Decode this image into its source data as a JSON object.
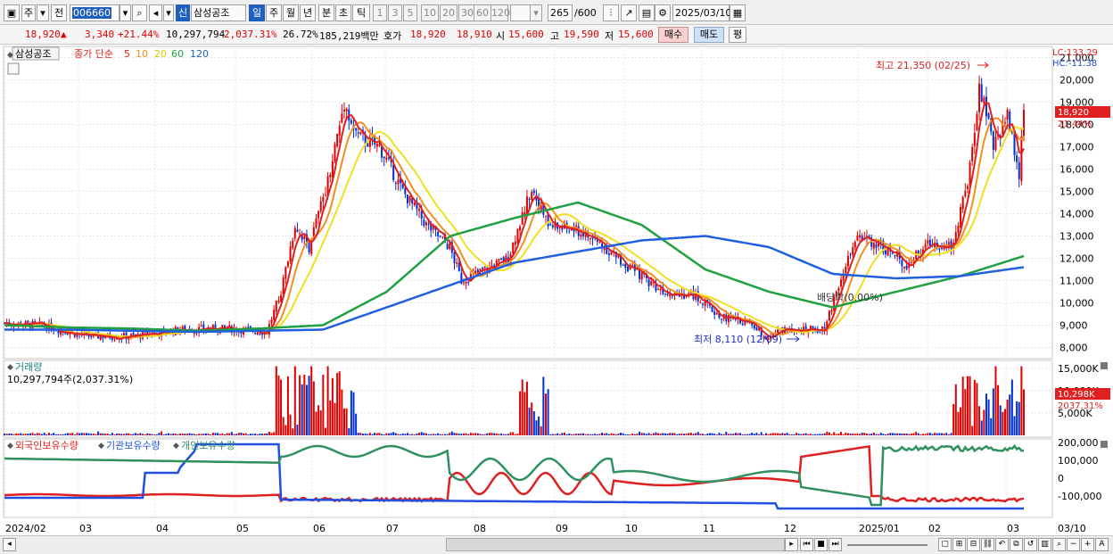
{
  "toolbar": {
    "period_tabs": [
      "주",
      "전"
    ],
    "stock_code": "006660",
    "new_badge": "신",
    "stock_name": "삼성공조",
    "timeframes": [
      "일",
      "주",
      "월",
      "년",
      "분",
      "초",
      "틱"
    ],
    "tick_counts": [
      "1",
      "3",
      "5",
      "10",
      "20",
      "30",
      "60",
      "120"
    ],
    "view_count": "265",
    "view_total": "/600",
    "date": "2025/03/10"
  },
  "info": {
    "price": "18,920",
    "change": "3,340",
    "change_pct": "+21.44%",
    "volume": "10,297,794",
    "volume_pct": "2,037.31%",
    "turnover": "26.72%",
    "amount": "185,219백만",
    "quote_label": "호가",
    "ask": "18,920",
    "bid": "18,910",
    "open_label": "시",
    "open": "15,600",
    "high_label": "고",
    "high": "19,590",
    "low_label": "저",
    "low": "15,600",
    "buy_label": "매수",
    "sell_label": "매도",
    "avg_label": "평"
  },
  "colors": {
    "up": "#e00000",
    "down": "#0030d0",
    "ma5": "#e02020",
    "ma10": "#f09020",
    "ma20": "#f0e020",
    "ma60": "#20a040",
    "ma120": "#2060e0",
    "foreign": "#e02020",
    "institution": "#2050e0",
    "individual": "#309060"
  },
  "chart_data": [
    {
      "type": "candlestick",
      "panel": "price",
      "title": "삼성공조",
      "legend": [
        "종가 단순",
        "5",
        "10",
        "20",
        "60",
        "120"
      ],
      "lc_label": "LC:133.29",
      "hc_label": "HC:-11.38",
      "ylim": [
        7500,
        21500
      ],
      "yticks": [
        "8,000",
        "9,000",
        "10,000",
        "11,000",
        "12,000",
        "13,000",
        "14,000",
        "15,000",
        "16,000",
        "17,000",
        "18,000",
        "19,000",
        "20,000",
        "21,000"
      ],
      "current_price_label": "18,920",
      "current_pct_label": "21.44%",
      "annotations": {
        "high": "최고 21,350 (02/25)",
        "low": "최저 8,110 (12/09)",
        "dividend": "배당락(0.00%)"
      },
      "x_labels": [
        "2024/02",
        "03",
        "04",
        "05",
        "06",
        "07",
        "08",
        "09",
        "10",
        "11",
        "12",
        "2025/01",
        "02",
        "03"
      ],
      "x_right_label": "03/10",
      "ma_series": [
        {
          "name": "60",
          "values": [
            9000,
            8900,
            8850,
            8750,
            8850,
            9000,
            10500,
            13000,
            13800,
            14500,
            13500,
            11500,
            10500,
            9800,
            10500,
            11200,
            12100
          ]
        },
        {
          "name": "120",
          "values": [
            8800,
            8800,
            8750,
            8700,
            8750,
            8800,
            9800,
            10800,
            11800,
            12300,
            12800,
            13000,
            12500,
            11300,
            11100,
            11200,
            11600
          ]
        }
      ]
    },
    {
      "type": "bar",
      "panel": "volume",
      "title": "거래량",
      "subtitle": "10,297,794주(2,037.31%)",
      "yticks": [
        "5,000K",
        "10,000K",
        "15,000K"
      ],
      "current_label": "10,298K",
      "current_pct_label": "2037.31%"
    },
    {
      "type": "line",
      "panel": "holdings",
      "series": [
        {
          "name": "외국인보유수량"
        },
        {
          "name": "기관보유수량"
        },
        {
          "name": "개인보유수량"
        }
      ],
      "yticks": [
        "200,000",
        "100,000",
        "0",
        "-100,000"
      ]
    }
  ]
}
